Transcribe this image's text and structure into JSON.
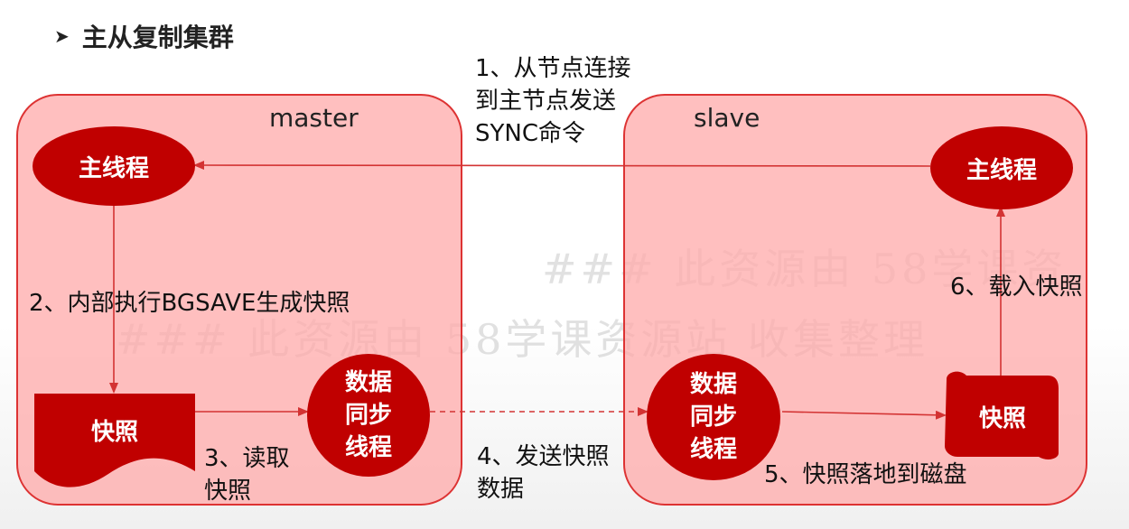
{
  "header": {
    "title": "主从复制集群"
  },
  "watermark": {
    "line1": "### 此资源由 58学课资",
    "line2": "### 此资源由 58学课资源站 收集整理"
  },
  "master": {
    "title": "master",
    "main_thread": "主线程",
    "snapshot": "快照",
    "sync_lines": [
      "数据",
      "同步",
      "线程"
    ]
  },
  "slave": {
    "title": "slave",
    "main_thread": "主线程",
    "snapshot": "快照",
    "sync_lines": [
      "数据",
      "同步",
      "线程"
    ]
  },
  "steps": {
    "step1": [
      "1、从节点连接",
      "到主节点发送",
      "SYNC命令"
    ],
    "step2": "2、内部执行BGSAVE生成快照",
    "step3": [
      "3、读取",
      "快照"
    ],
    "step4": [
      "4、发送快照",
      "数据"
    ],
    "step5": "5、快照落地到磁盘",
    "step6": "6、载入快照"
  },
  "colors": {
    "node": "#c00000",
    "panel": "#ffaaaa",
    "arrow": "#d33333"
  }
}
